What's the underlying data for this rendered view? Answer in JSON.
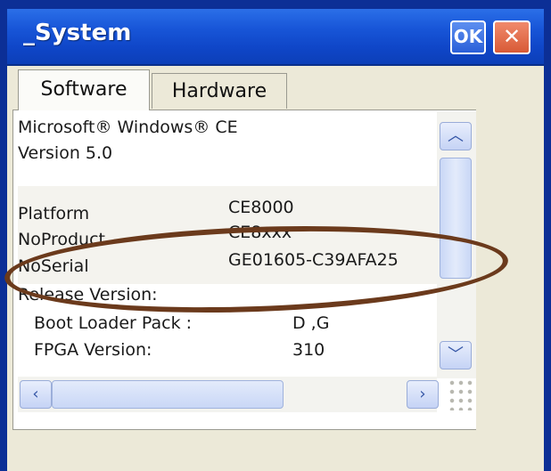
{
  "window": {
    "title": "_System",
    "ok_label": "OK",
    "close_label": "✕"
  },
  "tabs": [
    {
      "label": "Software",
      "selected": true
    },
    {
      "label": "Hardware",
      "selected": false
    }
  ],
  "software": {
    "os_line": "Microsoft® Windows® CE",
    "version_line": "Version 5.0",
    "rows": [
      {
        "label": "Platform",
        "value": "CE8000"
      },
      {
        "label": "NoProduct",
        "value": "CE8xxx"
      },
      {
        "label": "NoSerial",
        "value": "GE01605-C39AFA25"
      }
    ],
    "release_heading": "Release Version:",
    "release_rows": [
      {
        "label": "Boot Loader Pack :",
        "value": "D ,G"
      },
      {
        "label": "FPGA Version:",
        "value": "310"
      }
    ]
  },
  "icons": {
    "scroll_up": "chevron-up-icon",
    "scroll_down": "chevron-down-icon",
    "scroll_left": "chevron-left-icon",
    "scroll_right": "chevron-right-icon",
    "size_grip": "size-grip-icon"
  },
  "colors": {
    "titlebar": "#1856d8",
    "highlight_oval": "#6b3a1c",
    "close_button": "#d85a36"
  }
}
